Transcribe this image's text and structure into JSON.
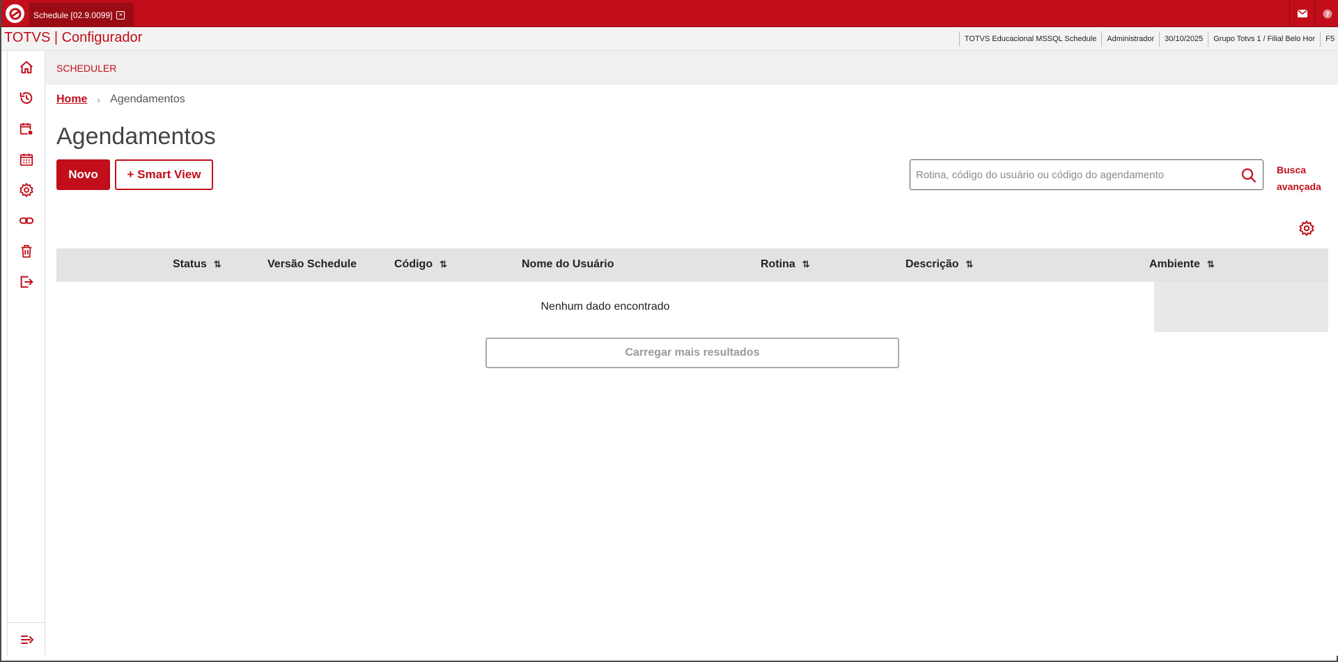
{
  "window": {
    "tab_label": "Schedule [02.9.0099]",
    "close_glyph": "×"
  },
  "header": {
    "app_title": "TOTVS | Configurador",
    "info": [
      "TOTVS Educacional MSSQL Schedule",
      "Administrador",
      "30/10/2025",
      "Grupo Totvs 1 / Filial Belo Hor",
      "F5"
    ]
  },
  "sidebar": {
    "items": [
      {
        "icon": "home-icon"
      },
      {
        "icon": "history-icon"
      },
      {
        "icon": "calendar-settings-icon"
      },
      {
        "icon": "calendar-icon"
      },
      {
        "icon": "gear-icon"
      },
      {
        "icon": "link-icon"
      },
      {
        "icon": "trash-icon"
      },
      {
        "icon": "logout-icon"
      }
    ],
    "collapse_icon": "expand-menu-icon"
  },
  "main": {
    "section_title": "SCHEDULER",
    "breadcrumb": {
      "home": "Home",
      "separator": "›",
      "current": "Agendamentos"
    },
    "page_title": "Agendamentos",
    "buttons": {
      "new": "Novo",
      "smart_view": "+ Smart View"
    },
    "search": {
      "placeholder": "Rotina, código do usuário ou código do agendamento",
      "value": ""
    },
    "advanced_search": "Busca avançada",
    "table": {
      "columns": [
        "Status",
        "Versão Schedule",
        "Código",
        "Nome do Usuário",
        "Rotina",
        "Descrição",
        "Ambiente"
      ],
      "sort_glyph": "⇅",
      "empty_message": "Nenhum dado encontrado"
    },
    "load_more": "Carregar mais resultados"
  },
  "colors": {
    "brand_red": "#c10e1a",
    "header_gray": "#f0f0f0"
  }
}
